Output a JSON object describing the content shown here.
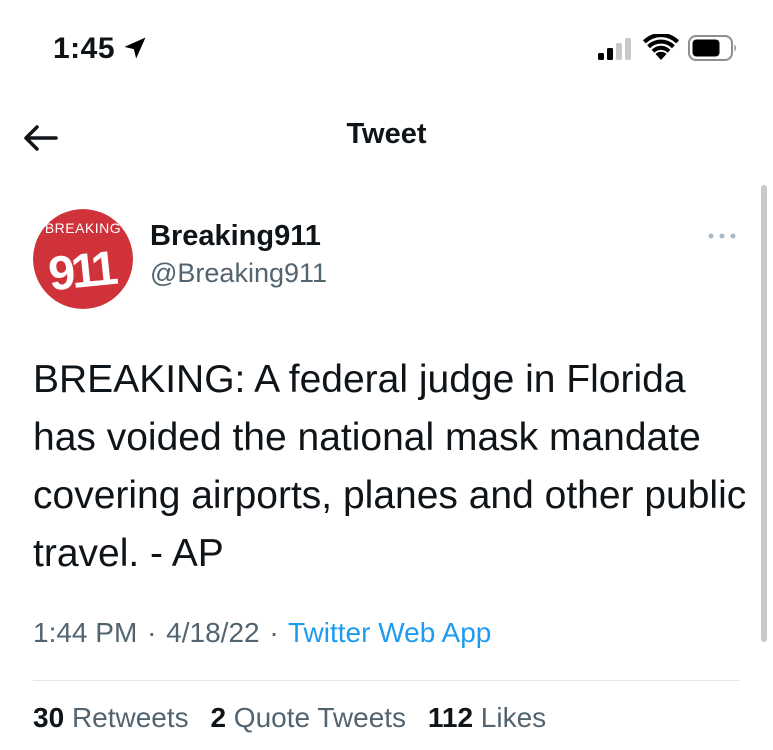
{
  "status_bar": {
    "time": "1:45",
    "icons": [
      "location-arrow-icon",
      "cellular-signal-icon",
      "wifi-icon",
      "battery-icon"
    ]
  },
  "header": {
    "title": "Tweet",
    "back_icon": "arrow-left-icon"
  },
  "tweet": {
    "author": {
      "name": "Breaking911",
      "handle": "@Breaking911",
      "avatar": {
        "top_text": "BREAKING",
        "number": "911",
        "color": "#d0323a"
      }
    },
    "more_icon": "ellipsis-icon",
    "text": "BREAKING: A federal judge in Florida has voided the national mask mandate covering airports, planes and other public travel. - AP",
    "time": "1:44 PM",
    "separator": "·",
    "date": "4/18/22",
    "source": "Twitter Web App",
    "stats": {
      "retweets": {
        "count": "30",
        "label": "Retweets"
      },
      "quote_tweets": {
        "count": "2",
        "label": "Quote Tweets"
      },
      "likes": {
        "count": "112",
        "label": "Likes"
      }
    }
  },
  "colors": {
    "text_primary": "#0f1419",
    "text_secondary": "#536471",
    "link": "#1d9bf0",
    "avatar_red": "#d0323a"
  }
}
